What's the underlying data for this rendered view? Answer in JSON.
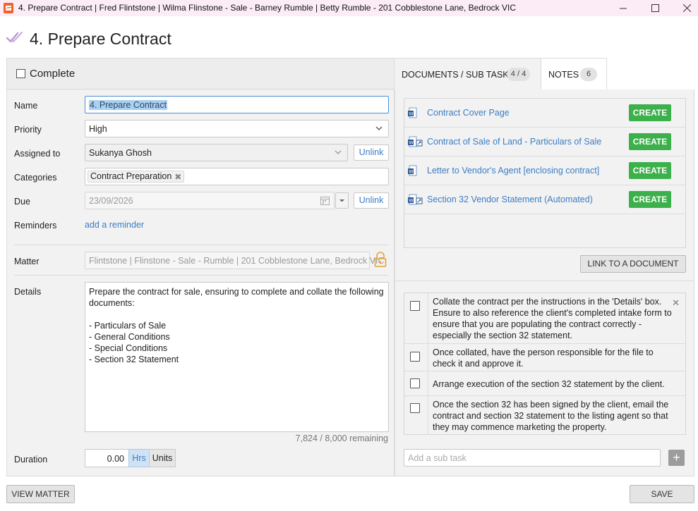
{
  "window": {
    "title": "4. Prepare Contract | Fred Flintstone | Wilma Flinstone - Sale - Barney Rumble | Betty Rumble - 201 Cobblestone Lane, Bedrock VIC",
    "icons": [
      "app-logo-icon",
      "minimize-icon",
      "maximize-icon",
      "close-icon"
    ]
  },
  "header": {
    "title": "4. Prepare Contract",
    "icon": "checkmark-task-icon"
  },
  "complete": {
    "label": "Complete",
    "checked": false
  },
  "form": {
    "name": {
      "label": "Name",
      "value": "4. Prepare Contract"
    },
    "priority": {
      "label": "Priority",
      "value": "High"
    },
    "assigned": {
      "label": "Assigned to",
      "value": "Sukanya Ghosh",
      "unlink": "Unlink"
    },
    "categories": {
      "label": "Categories",
      "tags": [
        "Contract Preparation"
      ]
    },
    "due": {
      "label": "Due",
      "value": "23/09/2026",
      "unlink": "Unlink"
    },
    "reminders": {
      "label": "Reminders",
      "link": "add a reminder"
    },
    "matter": {
      "label": "Matter",
      "value": "Flintstone | Flinstone - Sale - Rumble | 201 Cobblestone Lane, Bedrock VIC"
    },
    "details": {
      "label": "Details",
      "value": "Prepare the contract for sale, ensuring to complete and collate the following documents:\n\n- Particulars of Sale\n- General Conditions\n- Special Conditions\n- Section 32 Statement",
      "counter": "7,824 / 8,000 remaining"
    },
    "duration": {
      "label": "Duration",
      "value": "0.00",
      "hrs": "Hrs",
      "units": "Units"
    }
  },
  "tabs": [
    {
      "label": "DOCUMENTS / SUB TASKS",
      "badge": "4 / 4",
      "active": true
    },
    {
      "label": "NOTES",
      "badge": "6",
      "active": false
    }
  ],
  "documents": [
    {
      "name": "Contract Cover Page",
      "action": "CREATE",
      "icon": "word-document-icon"
    },
    {
      "name": "Contract of Sale of Land - Particulars of Sale",
      "action": "CREATE",
      "icon": "word-document-link-icon"
    },
    {
      "name": "Letter to Vendor's Agent [enclosing contract]",
      "action": "CREATE",
      "icon": "word-document-icon"
    },
    {
      "name": "Section 32 Vendor Statement (Automated)",
      "action": "CREATE",
      "icon": "word-document-link-icon"
    }
  ],
  "link_document": "LINK TO A DOCUMENT",
  "subtasks": [
    {
      "text": "Collate the contract per the instructions in the 'Details' box. Ensure to also reference the client's completed intake form to ensure that you are populating the contract correctly - especially the section 32 statement.",
      "checked": false
    },
    {
      "text": "Once collated, have the person responsible for the file to check it and approve it.",
      "checked": false
    },
    {
      "text": "Arrange execution of the section 32 statement by the client.",
      "checked": false
    },
    {
      "text": "Once the section 32 has been signed by the client, email the contract and section 32 statement to the listing agent so that they may commence marketing the property.",
      "checked": false
    }
  ],
  "subtask_input": {
    "placeholder": "Add a sub task"
  },
  "footer": {
    "view_matter": "VIEW MATTER",
    "save": "SAVE"
  },
  "colors": {
    "accent": "#3b7dc4",
    "create": "#3cb04a",
    "title_bar": "#fcecf6",
    "header_icon": "#b68fd6"
  }
}
